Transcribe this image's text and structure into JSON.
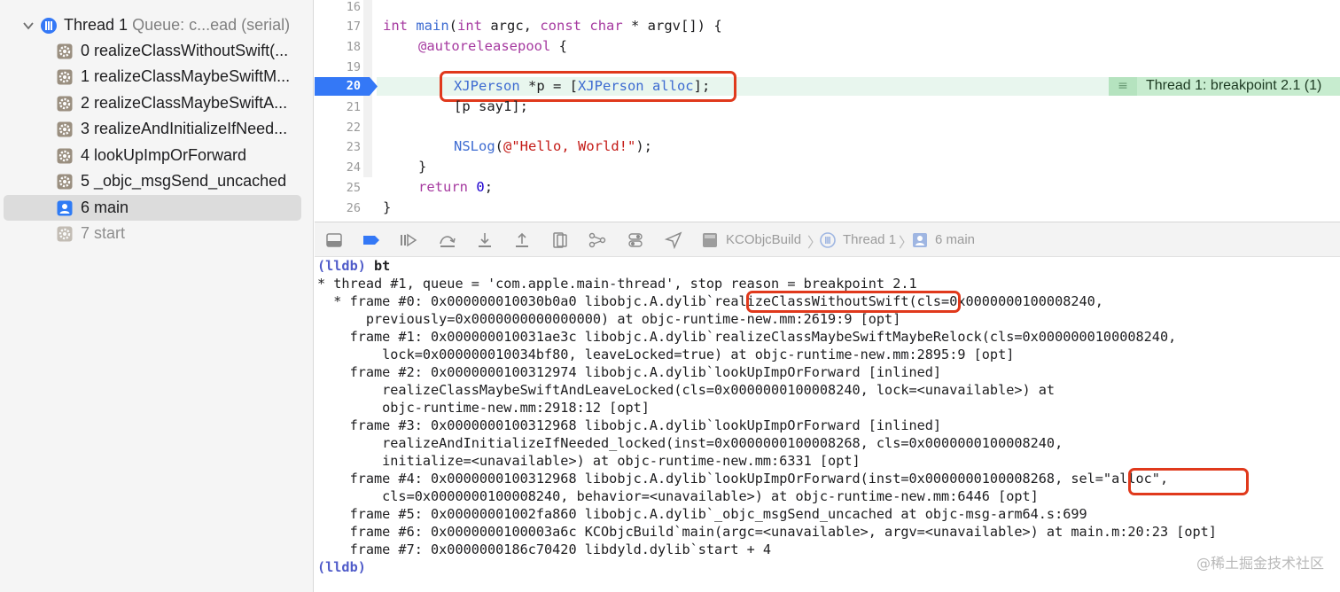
{
  "navigator": {
    "thread": {
      "title": "Thread 1",
      "queue": "Queue: c...ead (serial)"
    },
    "frames": [
      {
        "label": "0 realizeClassWithoutSwift(...",
        "icon": "gear-frame-icon"
      },
      {
        "label": "1 realizeClassMaybeSwiftM...",
        "icon": "gear-frame-icon"
      },
      {
        "label": "2 realizeClassMaybeSwiftA...",
        "icon": "gear-frame-icon"
      },
      {
        "label": "3 realizeAndInitializeIfNeed...",
        "icon": "gear-frame-icon"
      },
      {
        "label": "4 lookUpImpOrForward",
        "icon": "gear-frame-icon"
      },
      {
        "label": "5 _objc_msgSend_uncached",
        "icon": "gear-frame-icon"
      },
      {
        "label": "6 main",
        "icon": "person-frame-icon",
        "selected": true
      },
      {
        "label": "7 start",
        "icon": "gear-frame-icon",
        "dim": true
      }
    ]
  },
  "editor": {
    "line_numbers": [
      "16",
      "17",
      "18",
      "19",
      "20",
      "21",
      "22",
      "23",
      "24",
      "25",
      "26"
    ],
    "breakpoint_line": "20",
    "code": {
      "l17_kw1": "int",
      "l17_fn": "main",
      "l17_p1": "(",
      "l17_kw2": "int",
      "l17_p2": " argc, ",
      "l17_kw3": "const",
      "l17_kw4": "char",
      "l17_p3": " * argv[]) {",
      "l18_kw": "@autoreleasepool",
      "l18_p": " {",
      "l20_ty1": "XJPerson",
      "l20_p1": " *p = [",
      "l20_ty2": "XJPerson",
      "l20_p2": " ",
      "l20_fn": "alloc",
      "l20_p3": "];",
      "l21": "[p say1];",
      "l23_fn": "NSLog",
      "l23_p1": "(",
      "l23_str": "@\"Hello, World!\"",
      "l23_p2": ");",
      "l24": "}",
      "l25_kw": "return",
      "l25_p1": " ",
      "l25_num": "0",
      "l25_p2": ";",
      "l26": "}"
    },
    "breakpoint_banner": "Thread 1: breakpoint 2.1 (1)"
  },
  "debug_bar": {
    "breadcrumb": [
      "KCObjcBuild",
      "Thread 1",
      "6 main"
    ]
  },
  "console": {
    "prompt": "(lldb)",
    "command": "bt",
    "lines": [
      "* thread #1, queue = 'com.apple.main-thread', stop reason = breakpoint 2.1",
      "  * frame #0: 0x000000010030b0a0 libobjc.A.dylib`realizeClassWithoutSwift(cls=0x0000000100008240,",
      "      previously=0x0000000000000000) at objc-runtime-new.mm:2619:9 [opt]",
      "    frame #1: 0x000000010031ae3c libobjc.A.dylib`realizeClassMaybeSwiftMaybeRelock(cls=0x0000000100008240,",
      "        lock=0x000000010034bf80, leaveLocked=true) at objc-runtime-new.mm:2895:9 [opt]",
      "    frame #2: 0x0000000100312974 libobjc.A.dylib`lookUpImpOrForward [inlined]",
      "        realizeClassMaybeSwiftAndLeaveLocked(cls=0x0000000100008240, lock=<unavailable>) at",
      "        objc-runtime-new.mm:2918:12 [opt]",
      "    frame #3: 0x0000000100312968 libobjc.A.dylib`lookUpImpOrForward [inlined]",
      "        realizeAndInitializeIfNeeded_locked(inst=0x0000000100008268, cls=0x0000000100008240,",
      "        initialize=<unavailable>) at objc-runtime-new.mm:6331 [opt]",
      "    frame #4: 0x0000000100312968 libobjc.A.dylib`lookUpImpOrForward(inst=0x0000000100008268, sel=\"alloc\",",
      "        cls=0x0000000100008240, behavior=<unavailable>) at objc-runtime-new.mm:6446 [opt]",
      "    frame #5: 0x00000001002fa860 libobjc.A.dylib`_objc_msgSend_uncached at objc-msg-arm64.s:699",
      "    frame #6: 0x0000000100003a6c KCObjcBuild`main(argc=<unavailable>, argv=<unavailable>) at main.m:20:23 [opt]",
      "    frame #7: 0x0000000186c70420 libdyld.dylib`start + 4"
    ],
    "final_prompt": "(lldb)",
    "watermark": "@稀土掘金技术社区"
  },
  "colors": {
    "highlight_box": "#e0391c",
    "breakpoint_blue": "#3478f6",
    "lldb_prompt": "#4f5bc9"
  }
}
